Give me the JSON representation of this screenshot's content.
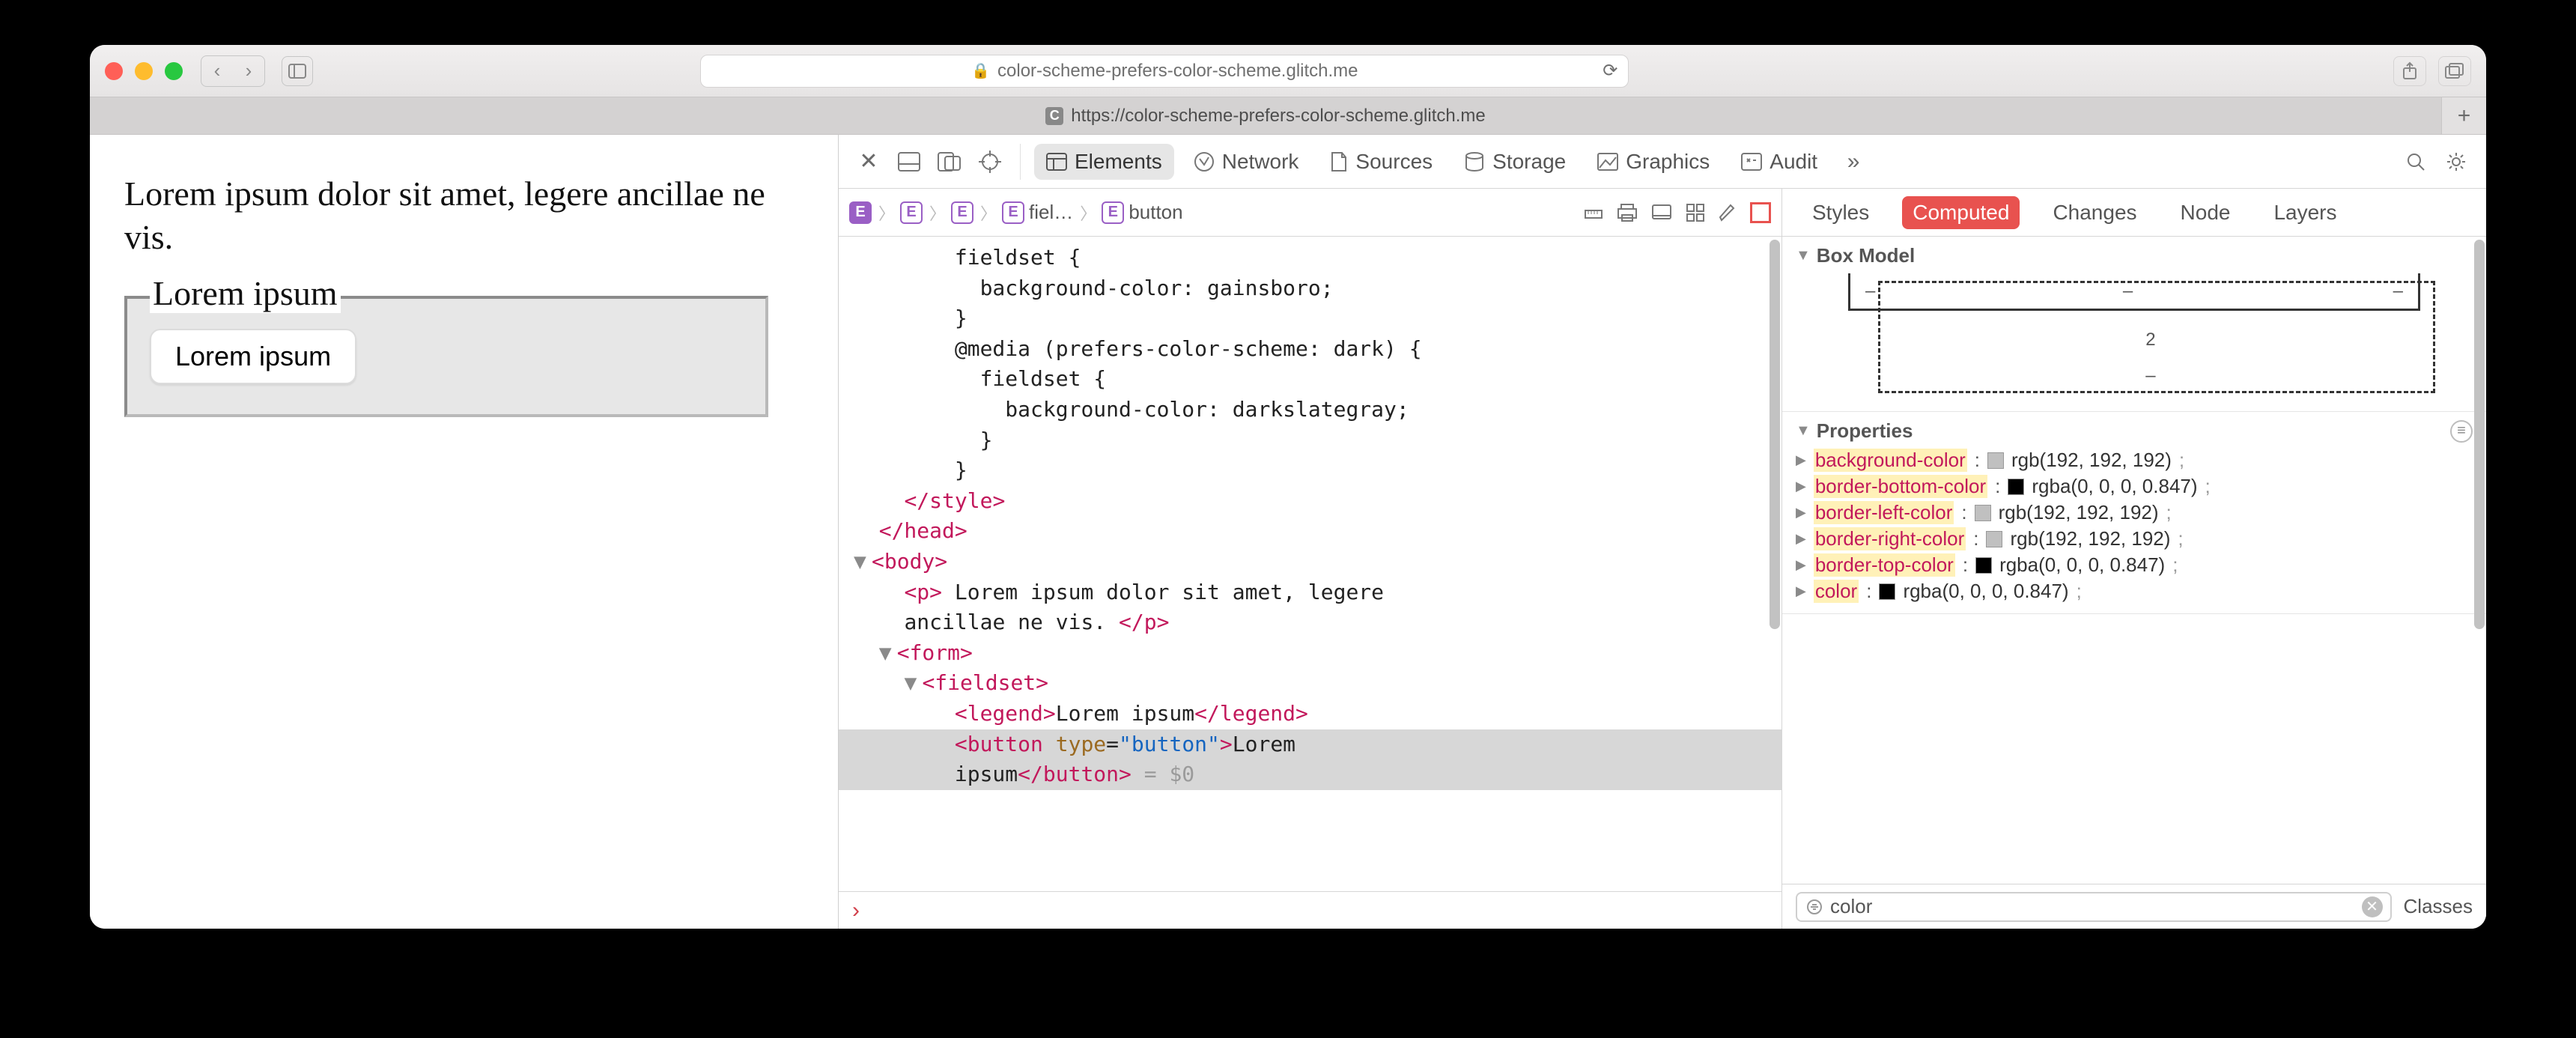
{
  "browser": {
    "url_display": "color-scheme-prefers-color-scheme.glitch.me",
    "tab_url": "https://color-scheme-prefers-color-scheme.glitch.me",
    "tab_favicon_letter": "C"
  },
  "page": {
    "paragraph": "Lorem ipsum dolor sit amet, legere ancillae ne vis.",
    "legend": "Lorem ipsum",
    "button_label": "Lorem ipsum"
  },
  "devtools": {
    "tabs": {
      "elements": "Elements",
      "network": "Network",
      "sources": "Sources",
      "storage": "Storage",
      "graphics": "Graphics",
      "audit": "Audit"
    },
    "breadcrumb": {
      "items": [
        "",
        "",
        "",
        "fiel…",
        "button"
      ]
    },
    "dom_lines": [
      {
        "indent": 8,
        "html": "fieldset {"
      },
      {
        "indent": 10,
        "html": "background-color: gainsboro;"
      },
      {
        "indent": 8,
        "html": "}"
      },
      {
        "indent": 8,
        "html": "@media (prefers-color-scheme: dark) {"
      },
      {
        "indent": 10,
        "html": "fieldset {"
      },
      {
        "indent": 12,
        "html": "background-color: darkslategray;"
      },
      {
        "indent": 10,
        "html": "}"
      },
      {
        "indent": 8,
        "html": "}"
      },
      {
        "indent": 4,
        "tag_close": "style"
      },
      {
        "indent": 2,
        "tag_close": "head"
      },
      {
        "indent": 2,
        "twisty": "▼",
        "tag_open": "body"
      },
      {
        "indent": 4,
        "p_line": true
      },
      {
        "indent": 4,
        "p_line2": true
      },
      {
        "indent": 4,
        "twisty": "▼",
        "tag_open": "form"
      },
      {
        "indent": 6,
        "twisty": "▼",
        "tag_open": "fieldset"
      },
      {
        "indent": 8,
        "legend_line": true
      },
      {
        "indent": 8,
        "button_line1": true,
        "hl": true
      },
      {
        "indent": 8,
        "button_line2": true,
        "hl": true
      }
    ],
    "p_text1": " Lorem ipsum dolor sit amet, legere",
    "p_text2": "ancillae ne vis. ",
    "legend_text": "Lorem ipsum",
    "button_text1": "Lorem",
    "button_text2": "ipsum",
    "console_ref": " = $0",
    "console_prompt": "›"
  },
  "sidebar": {
    "tabs": {
      "styles": "Styles",
      "computed": "Computed",
      "changes": "Changes",
      "node": "Node",
      "layers": "Layers"
    },
    "box_model_title": "Box Model",
    "box_model_bottom": "2",
    "properties_title": "Properties",
    "props": [
      {
        "name": "background-color",
        "swatch": "#c0c0c0",
        "value": "rgb(192, 192, 192)"
      },
      {
        "name": "border-bottom-color",
        "swatch": "#000000",
        "value": "rgba(0, 0, 0, 0.847)"
      },
      {
        "name": "border-left-color",
        "swatch": "#c0c0c0",
        "value": "rgb(192, 192, 192)"
      },
      {
        "name": "border-right-color",
        "swatch": "#c0c0c0",
        "value": "rgb(192, 192, 192)"
      },
      {
        "name": "border-top-color",
        "swatch": "#000000",
        "value": "rgba(0, 0, 0, 0.847)"
      },
      {
        "name": "color",
        "swatch": "#000000",
        "value": "rgba(0, 0, 0, 0.847)"
      }
    ],
    "filter_value": "color",
    "classes_label": "Classes"
  }
}
